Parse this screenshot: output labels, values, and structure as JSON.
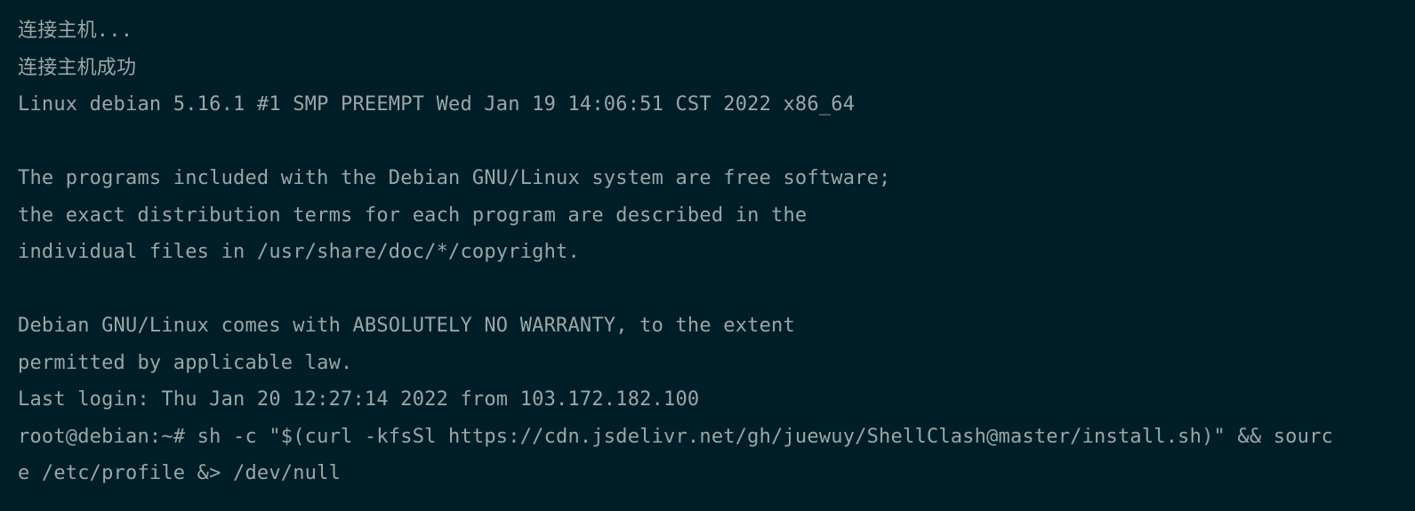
{
  "terminal": {
    "lines": [
      "连接主机...",
      "连接主机成功",
      "Linux debian 5.16.1 #1 SMP PREEMPT Wed Jan 19 14:06:51 CST 2022 x86_64",
      "",
      "The programs included with the Debian GNU/Linux system are free software;",
      "the exact distribution terms for each program are described in the",
      "individual files in /usr/share/doc/*/copyright.",
      "",
      "Debian GNU/Linux comes with ABSOLUTELY NO WARRANTY, to the extent",
      "permitted by applicable law.",
      "Last login: Thu Jan 20 12:27:14 2022 from 103.172.182.100",
      "root@debian:~# sh -c \"$(curl -kfsSl https://cdn.jsdelivr.net/gh/juewuy/ShellClash@master/install.sh)\" && sourc",
      "e /etc/profile &> /dev/null"
    ]
  },
  "colors": {
    "background": "#001e27",
    "foreground": "#9aa6a8"
  }
}
